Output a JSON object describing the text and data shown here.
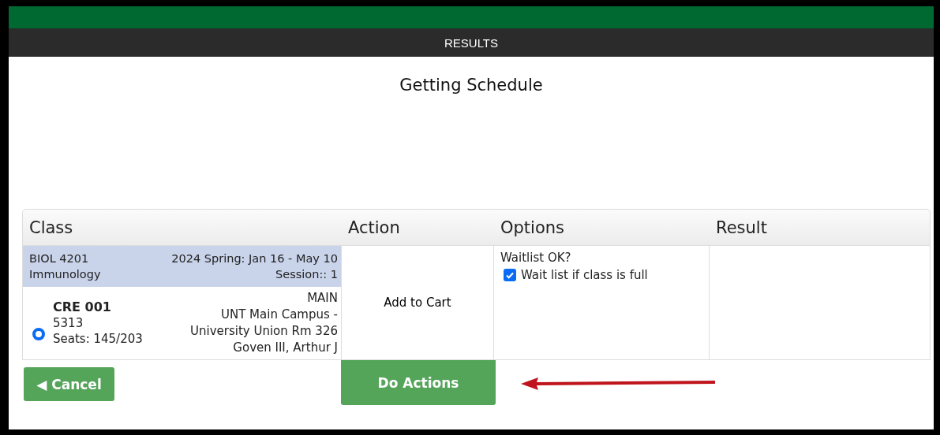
{
  "header": {
    "title": "RESULTS"
  },
  "heading": "Getting Schedule",
  "table": {
    "columns": [
      "Class",
      "Action",
      "Options",
      "Result"
    ],
    "rows": [
      {
        "course": "BIOL 4201",
        "term": "2024 Spring: Jan 16 - May 10",
        "course_title": "Immunology",
        "session": "Session:: 1",
        "section": {
          "selected": true,
          "code": "CRE 001",
          "number": "5313",
          "seats": "Seats: 145/203",
          "location": [
            "MAIN",
            "UNT Main Campus -",
            "University Union Rm 326",
            "Goven III, Arthur J"
          ]
        },
        "action": "Add to Cart",
        "options": {
          "label": "Waitlist OK?",
          "checkbox": {
            "label": "Wait list if class is full",
            "checked": true
          }
        }
      }
    ]
  },
  "buttons": {
    "cancel": "◀ Cancel",
    "do_actions": "Do Actions"
  }
}
